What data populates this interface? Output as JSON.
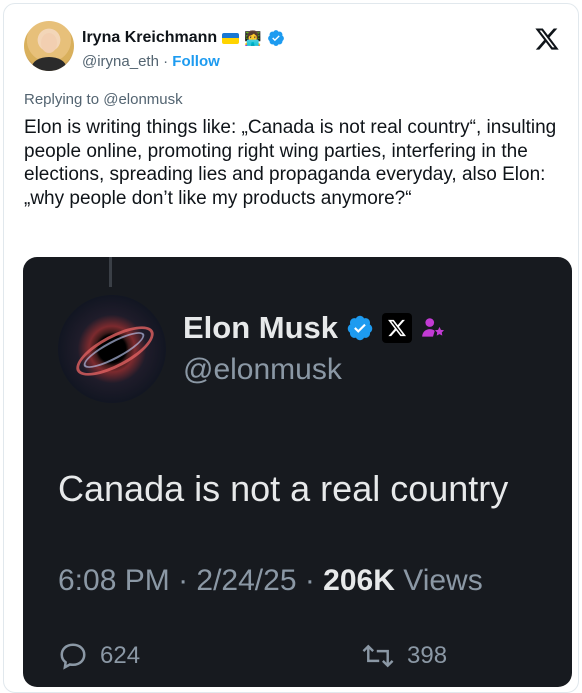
{
  "post": {
    "display_name": "Iryna Kreichmann",
    "handle": "@iryna_eth",
    "separator": "·",
    "follow_label": "Follow",
    "replying_to": "Replying to @elonmusk",
    "text": "Elon is writing things like: „Canada is not real country“, insulting people online, promoting right wing parties, interfering in the elections, spreading lies and propaganda everyday, also Elon: „why people don’t like my products anymore?“",
    "icons": [
      "ukraine-flag",
      "technologist-emoji",
      "verified-badge",
      "x-logo"
    ]
  },
  "embedded": {
    "display_name": "Elon Musk",
    "handle": "@elonmusk",
    "text": "Canada is not a real country",
    "time": "6:08 PM",
    "dot1": " · ",
    "date": "2/24/25",
    "dot2": " · ",
    "views_count": "206K",
    "views_label": " Views",
    "replies": "624",
    "reposts": "398",
    "icons": [
      "verified-badge",
      "x-logo",
      "affiliate-icon",
      "reply-icon",
      "repost-icon"
    ]
  },
  "colors": {
    "link": "#1d9bf0",
    "dark_card": "#171a1f",
    "muted_text": "#536471"
  }
}
